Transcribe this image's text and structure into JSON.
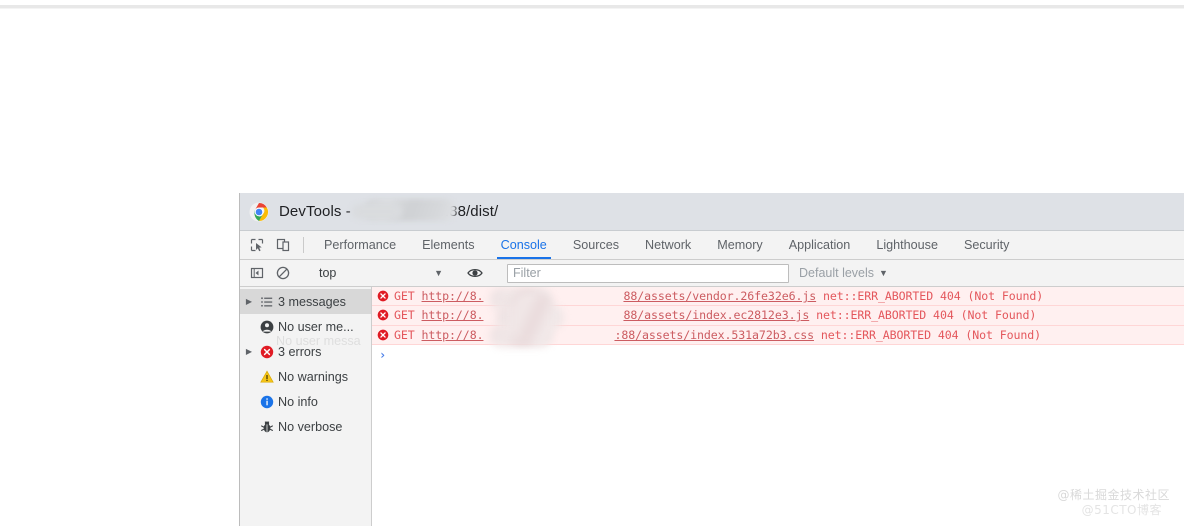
{
  "window": {
    "title_prefix": "DevTools - ",
    "title_suffix": ".88/dist/",
    "logo_icon": "chrome-logo-icon"
  },
  "tabstrip": {
    "inspect_icon": "inspect-element-icon",
    "device_icon": "device-toolbar-icon",
    "tabs": [
      {
        "label": "Performance",
        "active": false
      },
      {
        "label": "Elements",
        "active": false
      },
      {
        "label": "Console",
        "active": true
      },
      {
        "label": "Sources",
        "active": false
      },
      {
        "label": "Network",
        "active": false
      },
      {
        "label": "Memory",
        "active": false
      },
      {
        "label": "Application",
        "active": false
      },
      {
        "label": "Lighthouse",
        "active": false
      },
      {
        "label": "Security",
        "active": false
      }
    ]
  },
  "console_toolbar": {
    "sidebar_toggle_icon": "console-sidebar-toggle-icon",
    "clear_icon": "clear-console-icon",
    "context_value": "top",
    "context_caret": "▼",
    "eye_icon": "live-expression-eye-icon",
    "filter_placeholder": "Filter",
    "filter_value": "",
    "levels_label": "Default levels",
    "levels_caret": "▼"
  },
  "sidebar": {
    "ghost_text": "No user messa",
    "items": [
      {
        "label": "3 messages",
        "icon": "list-icon",
        "twisty": true,
        "selected": true
      },
      {
        "label": "No user me...",
        "icon": "user-message-icon",
        "twisty": false,
        "selected": false
      },
      {
        "label": "3 errors",
        "icon": "error-icon",
        "twisty": true,
        "selected": false
      },
      {
        "label": "No warnings",
        "icon": "warning-icon",
        "twisty": false,
        "selected": false
      },
      {
        "label": "No info",
        "icon": "info-icon",
        "twisty": false,
        "selected": false
      },
      {
        "label": "No verbose",
        "icon": "verbose-bug-icon",
        "twisty": false,
        "selected": false
      }
    ]
  },
  "console": {
    "prompt_arrow": "›",
    "messages": [
      {
        "icon": "error-icon",
        "method": "GET ",
        "url_head": "http://8.",
        "url_tail": "88/assets/vendor.26fe32e6.js",
        "status": " net::ERR_ABORTED 404 (Not Found)"
      },
      {
        "icon": "error-icon",
        "method": "GET ",
        "url_head": "http://8.",
        "url_tail": "88/assets/index.ec2812e3.js",
        "status": " net::ERR_ABORTED 404 (Not Found)"
      },
      {
        "icon": "error-icon",
        "method": "GET ",
        "url_head": "http://8.",
        "url_tail": ":88/assets/index.531a72b3.css",
        "status": " net::ERR_ABORTED 404 (Not Found)"
      }
    ]
  },
  "watermarks": {
    "primary": "@稀土掘金技术社区",
    "secondary": "@51CTO博客"
  },
  "colors": {
    "accent": "#1a73e8",
    "error": "#e4575c",
    "titlebar": "#dee1e6",
    "toolbar": "#f3f3f3",
    "error_row_bg": "#fff0f0"
  }
}
